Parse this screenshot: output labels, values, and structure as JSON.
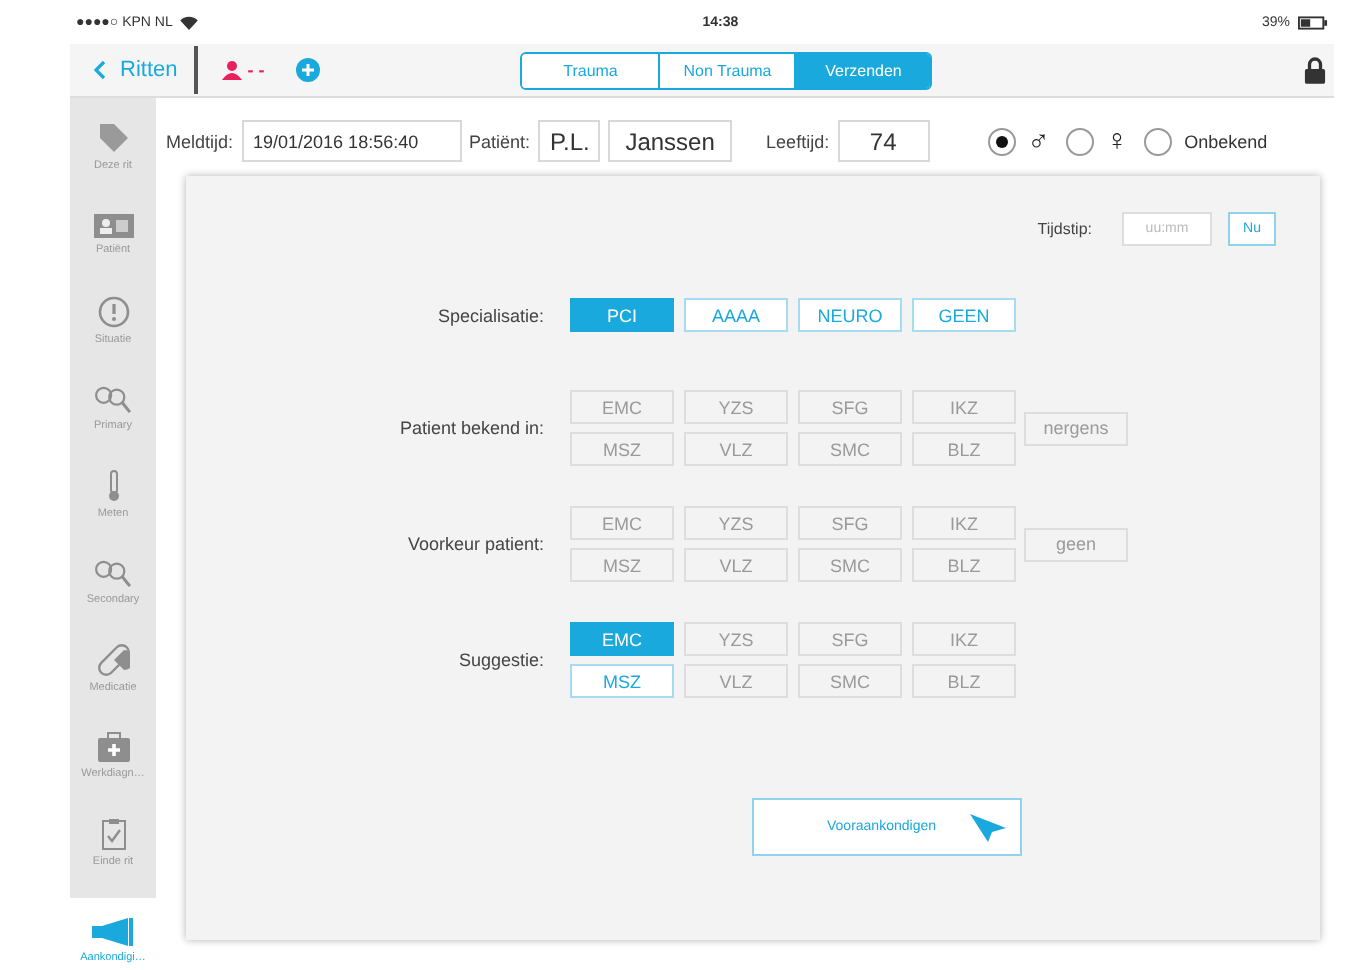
{
  "status_bar": {
    "carrier": "●●●●○ KPN NL",
    "time": "14:38",
    "battery": "39%"
  },
  "nav": {
    "back": "Ritten",
    "patient_marker": "- -",
    "tabs": [
      {
        "label": "Trauma",
        "selected": false
      },
      {
        "label": "Non Trauma",
        "selected": false
      },
      {
        "label": "Verzenden",
        "selected": true
      }
    ]
  },
  "sidebar": {
    "items": [
      {
        "label": "Deze rit",
        "selected": false
      },
      {
        "label": "Patiënt",
        "selected": false
      },
      {
        "label": "Situatie",
        "selected": false
      },
      {
        "label": "Primary",
        "selected": false
      },
      {
        "label": "Meten",
        "selected": false
      },
      {
        "label": "Secondary",
        "selected": false
      },
      {
        "label": "Medicatie",
        "selected": false
      },
      {
        "label": "Werkdiagn…",
        "selected": false
      },
      {
        "label": "Einde rit",
        "selected": false
      },
      {
        "label": "Aankondigi…",
        "selected": true
      }
    ]
  },
  "header": {
    "meldtijd_label": "Meldtijd:",
    "meldtijd": "19/01/2016 18:56:40",
    "patient_label": "Patiënt:",
    "initials": "P.L.",
    "surname": "Janssen",
    "age_label": "Leeftijd:",
    "age": "74",
    "genders": [
      {
        "symbol": "♂",
        "selected": true
      },
      {
        "symbol": "♀",
        "selected": false
      },
      {
        "label": "Onbekend",
        "selected": false
      }
    ]
  },
  "panel": {
    "tijdstip_label": "Tijdstip:",
    "tijdstip_placeholder": "uu:mm",
    "now_button": "Nu",
    "sections": [
      {
        "label": "Specialisatie:",
        "rows": [
          [
            {
              "label": "PCI",
              "selected": true,
              "disabled": false
            },
            {
              "label": "AAAA",
              "selected": false,
              "disabled": false
            },
            {
              "label": "NEURO",
              "selected": false,
              "disabled": false
            },
            {
              "label": "GEEN",
              "selected": false,
              "disabled": false
            }
          ]
        ]
      },
      {
        "label": "Patient bekend in:",
        "rows": [
          [
            {
              "label": "EMC",
              "selected": false,
              "disabled": true
            },
            {
              "label": "YZS",
              "selected": false,
              "disabled": true
            },
            {
              "label": "SFG",
              "selected": false,
              "disabled": true
            },
            {
              "label": "IKZ",
              "selected": false,
              "disabled": true
            }
          ],
          [
            {
              "label": "MSZ",
              "selected": false,
              "disabled": true
            },
            {
              "label": "VLZ",
              "selected": false,
              "disabled": true
            },
            {
              "label": "SMC",
              "selected": false,
              "disabled": true
            },
            {
              "label": "BLZ",
              "selected": false,
              "disabled": true
            }
          ]
        ],
        "extra": {
          "label": "nergens",
          "selected": false,
          "disabled": true
        }
      },
      {
        "label": "Voorkeur patient:",
        "rows": [
          [
            {
              "label": "EMC",
              "selected": false,
              "disabled": true
            },
            {
              "label": "YZS",
              "selected": false,
              "disabled": true
            },
            {
              "label": "SFG",
              "selected": false,
              "disabled": true
            },
            {
              "label": "IKZ",
              "selected": false,
              "disabled": true
            }
          ],
          [
            {
              "label": "MSZ",
              "selected": false,
              "disabled": true
            },
            {
              "label": "VLZ",
              "selected": false,
              "disabled": true
            },
            {
              "label": "SMC",
              "selected": false,
              "disabled": true
            },
            {
              "label": "BLZ",
              "selected": false,
              "disabled": true
            }
          ]
        ],
        "extra": {
          "label": "geen",
          "selected": false,
          "disabled": true
        }
      },
      {
        "label": "Suggestie:",
        "rows": [
          [
            {
              "label": "EMC",
              "selected": true,
              "disabled": false
            },
            {
              "label": "YZS",
              "selected": false,
              "disabled": true
            },
            {
              "label": "SFG",
              "selected": false,
              "disabled": true
            },
            {
              "label": "IKZ",
              "selected": false,
              "disabled": true
            }
          ],
          [
            {
              "label": "MSZ",
              "selected": false,
              "disabled": false
            },
            {
              "label": "VLZ",
              "selected": false,
              "disabled": true
            },
            {
              "label": "SMC",
              "selected": false,
              "disabled": true
            },
            {
              "label": "BLZ",
              "selected": false,
              "disabled": true
            }
          ]
        ]
      }
    ],
    "submit": "Vooraankondigen"
  }
}
